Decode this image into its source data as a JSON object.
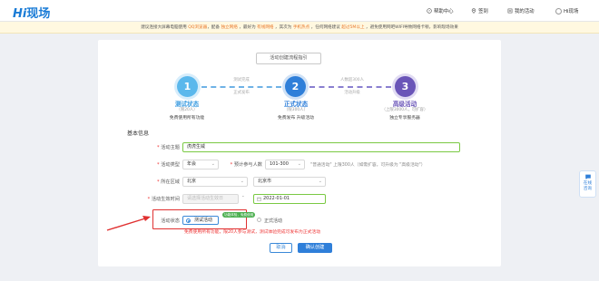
{
  "header": {
    "logo_prefix": "Hi",
    "logo_text": "现场",
    "nav": [
      {
        "label": "帮助中心",
        "icon": "help-icon"
      },
      {
        "label": "签到",
        "icon": "location-pin-icon"
      },
      {
        "label": "我的活动",
        "icon": "list-icon"
      },
      {
        "label": "Hi现场",
        "icon": "user-avatar-icon"
      }
    ]
  },
  "notice": {
    "parts": [
      {
        "text": "建议连接大屏幕电脑使用 ",
        "hl": false
      },
      {
        "text": "QQ浏览器",
        "hl": true
      },
      {
        "text": "，配备 ",
        "hl": false
      },
      {
        "text": "独立网络",
        "hl": true
      },
      {
        "text": " ，最好为 ",
        "hl": false
      },
      {
        "text": "有线网络",
        "hl": true
      },
      {
        "text": " ，其次为 ",
        "hl": false
      },
      {
        "text": "手机热点",
        "hl": true
      },
      {
        "text": " ，任何网络建议 ",
        "hl": false
      },
      {
        "text": "超过5M以上",
        "hl": true
      },
      {
        "text": " ，避免使用网吧WIFI导致网络卡顿，影响现场效果",
        "hl": false
      }
    ]
  },
  "guide": {
    "title": "活动创建流程指引",
    "steps": [
      {
        "num": "1",
        "name": "测试状态",
        "sub": "（限20人）",
        "desc": "免费使用所有功能",
        "color": "#3a9be0"
      },
      {
        "num": "2",
        "name": "正式状态",
        "sub": "（限300人）",
        "desc": "免费发布 升级活动",
        "color": "#2f7fd9"
      },
      {
        "num": "3",
        "name": "高级活动",
        "sub": "（上限3000人，可扩容）",
        "desc": "独立专享服务器",
        "color": "#6a55b8"
      }
    ],
    "connectors": [
      {
        "top": "测试完成",
        "bottom": "正式发布"
      },
      {
        "top": "人数超300人",
        "bottom": "活动升级"
      }
    ]
  },
  "form": {
    "section_title": "基本信息",
    "fields": {
      "theme": {
        "label": "活动主题",
        "value": "虎虎生威"
      },
      "type": {
        "label": "活动类型",
        "value": "年会"
      },
      "count": {
        "label": "预计参与人数",
        "value": "101-300",
        "hint": "\"普通活动\" 上限300人（如需扩容，可升级为 \"高级活动\"）"
      },
      "region": {
        "label": "所在区域",
        "province": "北京",
        "city": "北京市"
      },
      "time": {
        "label": "活动生效时间",
        "start_placeholder": "请选择活动生效日",
        "separator": "-",
        "end_value": "2022-01-01"
      },
      "state": {
        "label": "活动状态",
        "option_test": "测试活动",
        "badge": "功能体验，免费使用",
        "option_formal": "正式活动",
        "warning": "免费使用所有功能，限20人参与测试，测试体验完成可发布为正式活动"
      }
    },
    "cancel_label": "取消",
    "confirm_label": "确认创建"
  },
  "side_float": {
    "line1": "在线",
    "line2": "咨询"
  },
  "colors": {
    "primary": "#2f7fd9",
    "accent_orange": "#e9782a",
    "warning_red": "#e33333",
    "highlight_border": "#e03030"
  }
}
